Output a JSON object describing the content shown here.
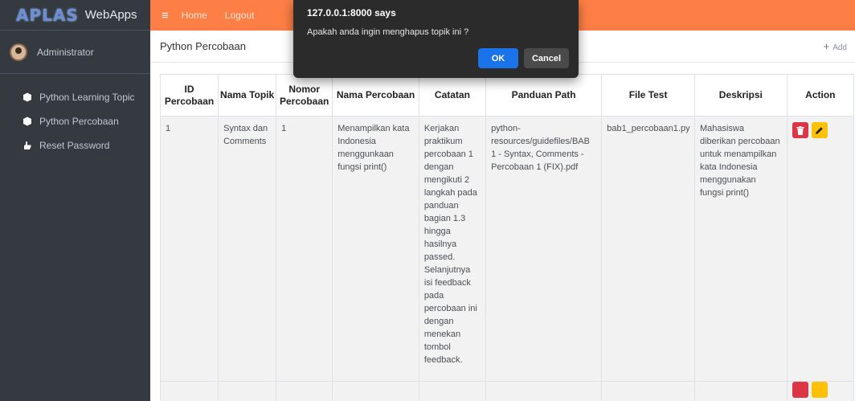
{
  "brand": {
    "logo": "APLAS",
    "name": "WebApps"
  },
  "user": {
    "name": "Administrator"
  },
  "sidebar": {
    "items": [
      {
        "label": "Python Learning Topic",
        "icon": "cube-icon"
      },
      {
        "label": "Python Percobaan",
        "icon": "cube-icon"
      },
      {
        "label": "Reset Password",
        "icon": "hand-icon"
      }
    ]
  },
  "topbar": {
    "menu_icon": "≡",
    "home": "Home",
    "logout": "Logout",
    "color": "#fe7f46"
  },
  "page": {
    "title": "Python Percobaan",
    "add_label": "Add"
  },
  "table": {
    "headers": [
      "ID Percobaan",
      "Nama Topik",
      "Nomor Percobaan",
      "Nama Percobaan",
      "Catatan",
      "Panduan Path",
      "File Test",
      "Deskripsi",
      "Action"
    ],
    "rows": [
      {
        "id": "1",
        "topik": "Syntax dan Comments",
        "nomor": "1",
        "nama": "Menampilkan kata Indonesia menggunkaan fungsi print()",
        "catatan": "Kerjakan praktikum percobaan 1 dengan mengikuti 2 langkah pada panduan bagian 1.3 hingga hasilnya passed. Selanjutnya isi feedback pada percobaan ini dengan menekan tombol feedback.",
        "panduan": "python-resources/guidefiles/BAB 1 - Syntax, Comments - Percobaan 1 (FIX).pdf",
        "file_test": "bab1_percobaan1.py",
        "deskripsi": "Mahasiswa diberikan percobaan untuk menampilkan kata Indonesia menggunakan fungsi print()"
      }
    ]
  },
  "dialog": {
    "title": "127.0.0.1:8000 says",
    "message": "Apakah anda ingin menghapus topik ini ?",
    "ok": "OK",
    "cancel": "Cancel"
  }
}
